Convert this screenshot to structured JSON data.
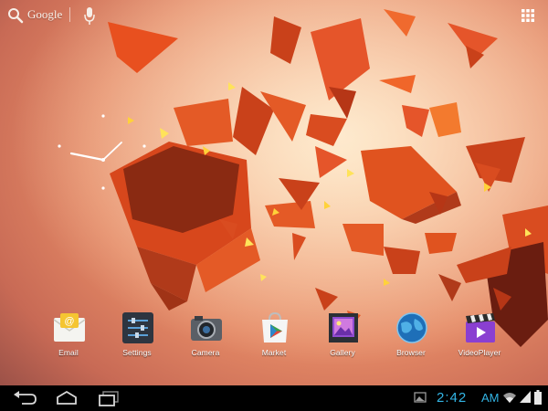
{
  "search": {
    "label": "Google"
  },
  "apps": [
    {
      "label": "Email",
      "icon": "email-icon"
    },
    {
      "label": "Settings",
      "icon": "settings-icon"
    },
    {
      "label": "Camera",
      "icon": "camera-icon"
    },
    {
      "label": "Market",
      "icon": "market-icon"
    },
    {
      "label": "Gallery",
      "icon": "gallery-icon"
    },
    {
      "label": "Browser",
      "icon": "browser-icon"
    },
    {
      "label": "VideoPlayer",
      "icon": "videoplayer-icon"
    }
  ],
  "status": {
    "time": "2:42",
    "ampm": "AM"
  },
  "colors": {
    "accent": "#33b5e5",
    "navbar": "#000000"
  }
}
